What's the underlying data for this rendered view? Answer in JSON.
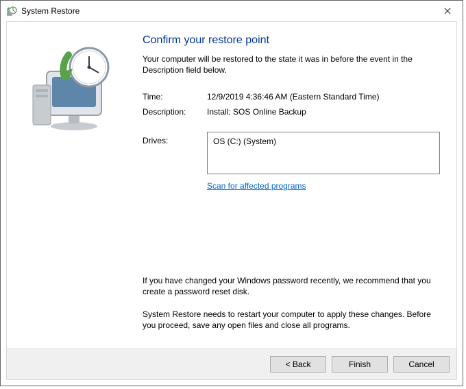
{
  "window": {
    "title": "System Restore"
  },
  "page": {
    "heading": "Confirm your restore point",
    "subtext": "Your computer will be restored to the state it was in before the event in the Description field below."
  },
  "info": {
    "time_label": "Time:",
    "time_value": "12/9/2019 4:36:46 AM (Eastern Standard Time)",
    "desc_label": "Description:",
    "desc_value": "Install: SOS Online Backup",
    "drives_label": "Drives:",
    "drives_value": "OS (C:) (System)"
  },
  "links": {
    "scan": "Scan for affected programs"
  },
  "notes": {
    "password": "If you have changed your Windows password recently, we recommend that you create a password reset disk.",
    "restart": "System Restore needs to restart your computer to apply these changes. Before you proceed, save any open files and close all programs."
  },
  "buttons": {
    "back": "< Back",
    "finish": "Finish",
    "cancel": "Cancel"
  }
}
